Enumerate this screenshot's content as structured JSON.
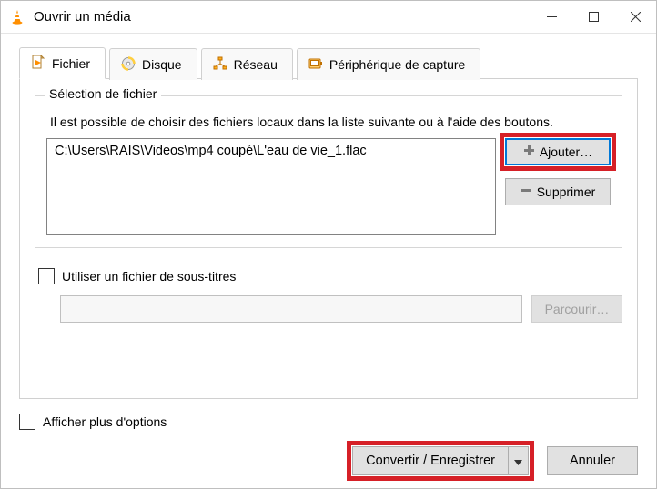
{
  "window": {
    "title": "Ouvrir un média"
  },
  "tabs": {
    "file": "Fichier",
    "disc": "Disque",
    "network": "Réseau",
    "capture": "Périphérique de capture"
  },
  "fileSelection": {
    "legend": "Sélection de fichier",
    "help": "Il est possible de choisir des fichiers locaux dans la liste suivante ou à l'aide des boutons.",
    "items": [
      "C:\\Users\\RAIS\\Videos\\mp4 coupé\\L'eau de vie_1.flac"
    ],
    "addLabel": "Ajouter…",
    "removeLabel": "Supprimer"
  },
  "subtitle": {
    "checkboxLabel": "Utiliser un fichier de sous-titres",
    "browseLabel": "Parcourir…"
  },
  "footer": {
    "showMoreLabel": "Afficher plus d'options",
    "convertLabel": "Convertir / Enregistrer",
    "cancelLabel": "Annuler"
  }
}
